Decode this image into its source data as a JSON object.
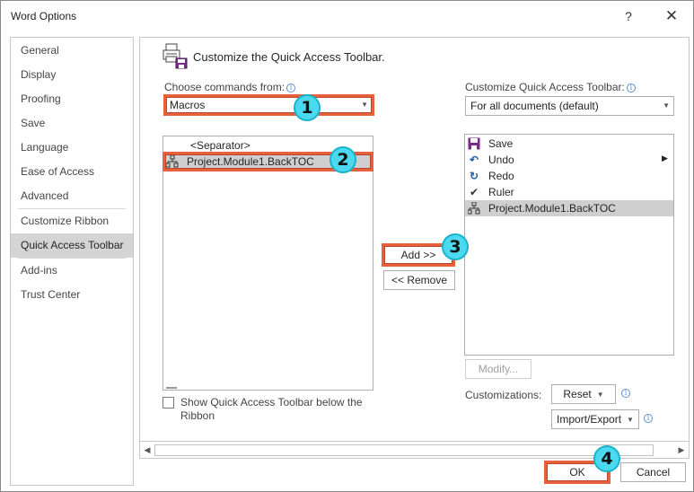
{
  "window": {
    "title": "Word Options",
    "help_glyph": "?",
    "close_glyph": "✕"
  },
  "sidebar": {
    "items": [
      {
        "label": "General"
      },
      {
        "label": "Display"
      },
      {
        "label": "Proofing"
      },
      {
        "label": "Save"
      },
      {
        "label": "Language"
      },
      {
        "label": "Ease of Access"
      },
      {
        "label": "Advanced"
      },
      {
        "label": "Customize Ribbon"
      },
      {
        "label": "Quick Access Toolbar",
        "selected": true
      },
      {
        "label": "Add-ins"
      },
      {
        "label": "Trust Center"
      }
    ]
  },
  "main": {
    "heading": "Customize the Quick Access Toolbar.",
    "choose_label": "Choose commands from:",
    "choose_value": "Macros",
    "commands_list": [
      {
        "label": "<Separator>"
      },
      {
        "label": "Project.Module1.BackTOC",
        "icon": "macro-icon",
        "selected": true
      }
    ],
    "customize_label": "Customize Quick Access Toolbar:",
    "customize_value": "For all documents (default)",
    "toolbar_list": [
      {
        "label": "Save",
        "icon": "save-icon"
      },
      {
        "label": "Undo",
        "icon": "undo-icon"
      },
      {
        "label": "Redo",
        "icon": "redo-icon"
      },
      {
        "label": "Ruler",
        "icon": "checkmark-icon"
      },
      {
        "label": "Project.Module1.BackTOC",
        "icon": "macro-icon",
        "selected": true
      }
    ],
    "add_label": "Add >>",
    "remove_label": "<< Remove",
    "modify_label": "Modify...",
    "customizations_label": "Customizations:",
    "reset_label": "Reset",
    "import_export_label": "Import/Export",
    "show_below_label": "Show Quick Access Toolbar below the Ribbon"
  },
  "footer": {
    "ok_label": "OK",
    "cancel_label": "Cancel"
  },
  "callouts": [
    "1",
    "2",
    "3",
    "4"
  ],
  "colors": {
    "highlight": "#e8603c",
    "badge": "#4ad9ee",
    "selected_bg": "#d4d4d4"
  }
}
